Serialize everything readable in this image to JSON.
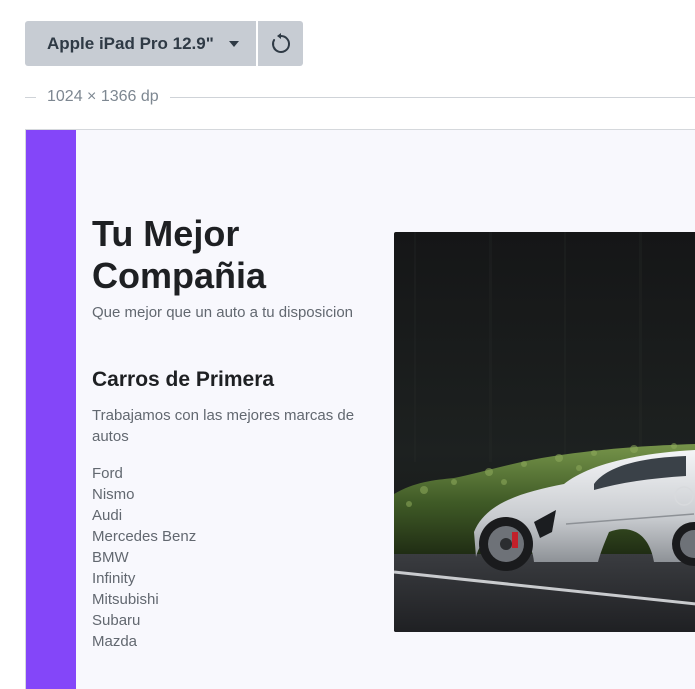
{
  "toolbar": {
    "device_label": "Apple iPad Pro 12.9\"",
    "dimensions": "1024 × 1366 dp"
  },
  "page": {
    "hero_title": "Tu Mejor Compañia",
    "hero_subtitle": "Que mejor que un auto a tu disposicion",
    "section_title": "Carros de Primera",
    "section_description": "Trabajamos con las mejores marcas de autos",
    "brands": [
      "Ford",
      "Nismo",
      "Audi",
      "Mercedes Benz",
      "BMW",
      "Infinity",
      "Mitsubishi",
      "Subaru",
      "Mazda"
    ]
  },
  "colors": {
    "accent": "#8446f9",
    "toolbar_button": "#c7ccd3",
    "page_background": "#f8f8fd"
  },
  "icons": {
    "device_caret": "caret-down-icon",
    "rotate": "rotate-icon"
  }
}
